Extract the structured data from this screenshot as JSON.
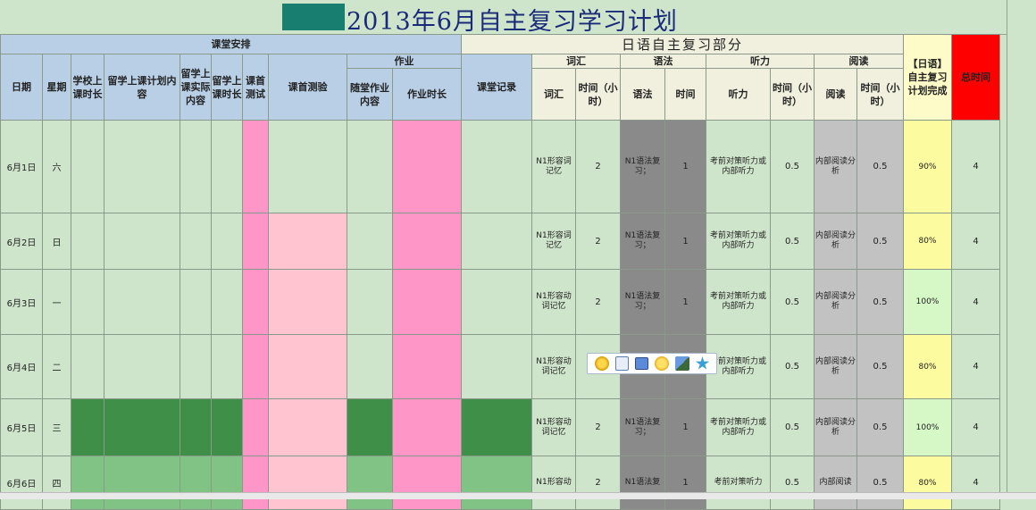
{
  "title": "2013年6月自主复习学习计划",
  "colors": {
    "title_block": "#177e70",
    "header_blue": "#b8cfe6",
    "pink": "#ff96c8",
    "light_pink": "#ffc4cf",
    "dark_gray": "#8a8a8a",
    "light_gray": "#c2c2c2",
    "red": "#ff0000",
    "yellow": "#fdfb9f",
    "light_green": "#d6f7c6",
    "dark_green": "#3f8f48",
    "mid_green": "#80c384",
    "sheet_green": "#cfe5cb"
  },
  "headers": {
    "class_section": "课堂安排",
    "jp_section": "日语自主复习部分",
    "total": "总时间",
    "completion": "【日语】自主复习计划完成",
    "date": "日期",
    "weekday": "星期",
    "school_hours": "学校上课时长",
    "study_plan": "留学上课计划内容",
    "study_actual": "留学上课实际内容",
    "study_hours": "留学上课时长",
    "first_test": "课首测试",
    "first_quiz": "课首测验",
    "homework": "作业",
    "hw_content": "随堂作业内容",
    "hw_hours": "作业时长",
    "class_record": "课堂记录",
    "vocab_group": "词汇",
    "grammar_group": "语法",
    "listening_group": "听力",
    "reading_group": "阅读",
    "vocab": "词汇",
    "vocab_time": "时间（小时）",
    "grammar": "语法",
    "grammar_time": "时间",
    "listening": "听力",
    "listening_time": "时间（小时）",
    "reading": "阅读",
    "reading_time": "时间（小时）"
  },
  "rows": [
    {
      "date": "6月1日",
      "weekday": "六",
      "vocab": "N1形容词记忆",
      "vocab_time": "2",
      "grammar": "N1语法复习；",
      "grammar_time": "1",
      "listening": "考前对策听力或内部听力",
      "listening_time": "0.5",
      "reading": "内部阅读分析",
      "reading_time": "0.5",
      "completion": "90%",
      "total": "4"
    },
    {
      "date": "6月2日",
      "weekday": "日",
      "vocab": "N1形容词记忆",
      "vocab_time": "2",
      "grammar": "N1语法复习；",
      "grammar_time": "1",
      "listening": "考前对策听力或内部听力",
      "listening_time": "0.5",
      "reading": "内部阅读分析",
      "reading_time": "0.5",
      "completion": "80%",
      "total": "4"
    },
    {
      "date": "6月3日",
      "weekday": "一",
      "vocab": "N1形容动词记忆",
      "vocab_time": "2",
      "grammar": "N1语法复习；",
      "grammar_time": "1",
      "listening": "考前对策听力或内部听力",
      "listening_time": "0.5",
      "reading": "内部阅读分析",
      "reading_time": "0.5",
      "completion": "100%",
      "total": "4"
    },
    {
      "date": "6月4日",
      "weekday": "二",
      "vocab": "N1形容动词记忆",
      "vocab_time": "",
      "grammar": "",
      "grammar_time": "",
      "listening": "考前对策听力或内部听力",
      "listening_time": "0.5",
      "reading": "内部阅读分析",
      "reading_time": "0.5",
      "completion": "80%",
      "total": "4"
    },
    {
      "date": "6月5日",
      "weekday": "三",
      "vocab": "N1形容动词记忆",
      "vocab_time": "2",
      "grammar": "N1语法复习；",
      "grammar_time": "1",
      "listening": "考前对策听力或内部听力",
      "listening_time": "0.5",
      "reading": "内部阅读分析",
      "reading_time": "0.5",
      "completion": "100%",
      "total": "4"
    },
    {
      "date": "6月6日",
      "weekday": "四",
      "vocab": "N1形容动",
      "vocab_time": "2",
      "grammar": "N1语法复",
      "grammar_time": "1",
      "listening": "考前对策听力",
      "listening_time": "0.5",
      "reading": "内部阅读",
      "reading_time": "0.5",
      "completion": "80%",
      "total": "4"
    }
  ],
  "toolbar": {
    "icons": [
      "plugin-icon",
      "save-icon",
      "screen-icon",
      "emoji-icon",
      "image-icon",
      "star-icon"
    ]
  }
}
